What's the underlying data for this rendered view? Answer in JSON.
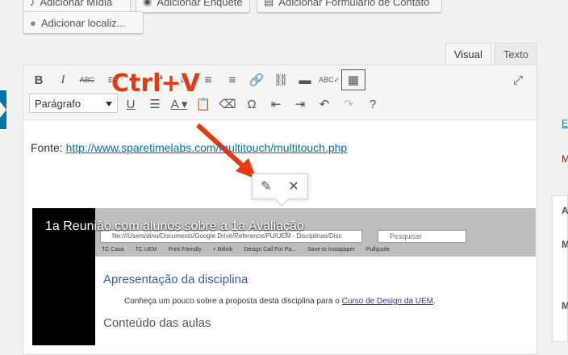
{
  "top_buttons": {
    "add_media": "Adicionar Mídia",
    "add_poll": "Adicionar Enquete",
    "add_contact_form": "Adicionar Formulário de Contato",
    "add_location": "Adicionar localiz..."
  },
  "tabs": {
    "visual": "Visual",
    "text": "Texto"
  },
  "toolbar": {
    "format_select": "Parágrafo"
  },
  "callout": "Ctrl+V",
  "content": {
    "source_label": "Fonte: ",
    "source_link": "http://www.sparetimelabs.com/multitouch/multitouch.php"
  },
  "video": {
    "title": "1a Reunião com alunos sobre a 1a Avaliação",
    "url": "file:///Users/dino/Documents/Google Drive/Reference/PU/UEM - Disciplinas/Disc",
    "search_placeholder": "Pesquisar",
    "bookmarks": [
      "TC Casa",
      "TC UEM",
      "Print Friendly",
      "+ Bitlink",
      "Design Call For Pa...",
      "Save to Instapaper",
      "Pullquote"
    ],
    "heading": "Apresentação da disciplina",
    "body_text": "Conheça um pouco sobre a proposta desta disciplina para o ",
    "body_link": "Curso de Design da UEM",
    "body_end": ".",
    "subheading": "Conteúdo das aulas"
  },
  "sidebar": {
    "letter_e": "E",
    "letter_m": "M",
    "letter_a": "A",
    "letter_m2": "M",
    "letter_m3": "M"
  }
}
